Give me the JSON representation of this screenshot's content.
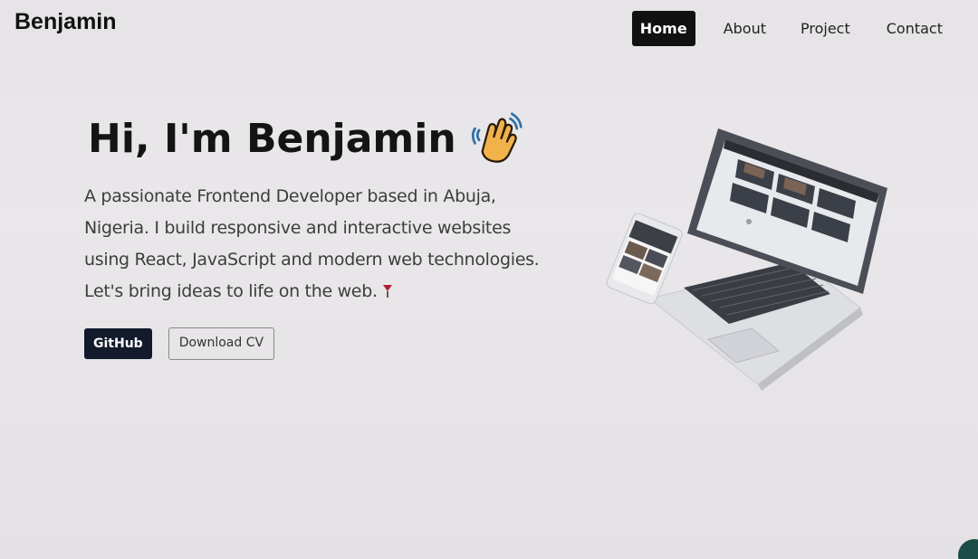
{
  "nav": {
    "brand": "Benjamin",
    "links": [
      "Home",
      "About",
      "Project",
      "Contact"
    ],
    "active": "Home"
  },
  "hero": {
    "title": "Hi, I'm Benjamin",
    "wave_icon": "waving-hand-icon",
    "lines": [
      "A passionate Frontend Developer based in Abuja,",
      "Nigeria. I build responsive and interactive websites",
      "using React, JavaScript and modern web technologies.",
      "Let's bring ideas to life on the web."
    ],
    "trailing_icon": "rose-icon"
  },
  "buttons": {
    "github": "GitHub",
    "cv": "Download CV"
  },
  "illustration": "laptop-and-phone-image",
  "colors": {
    "nav_active_bg": "#111111",
    "github_bg": "#121a2c",
    "background": "#e8e6e8"
  }
}
